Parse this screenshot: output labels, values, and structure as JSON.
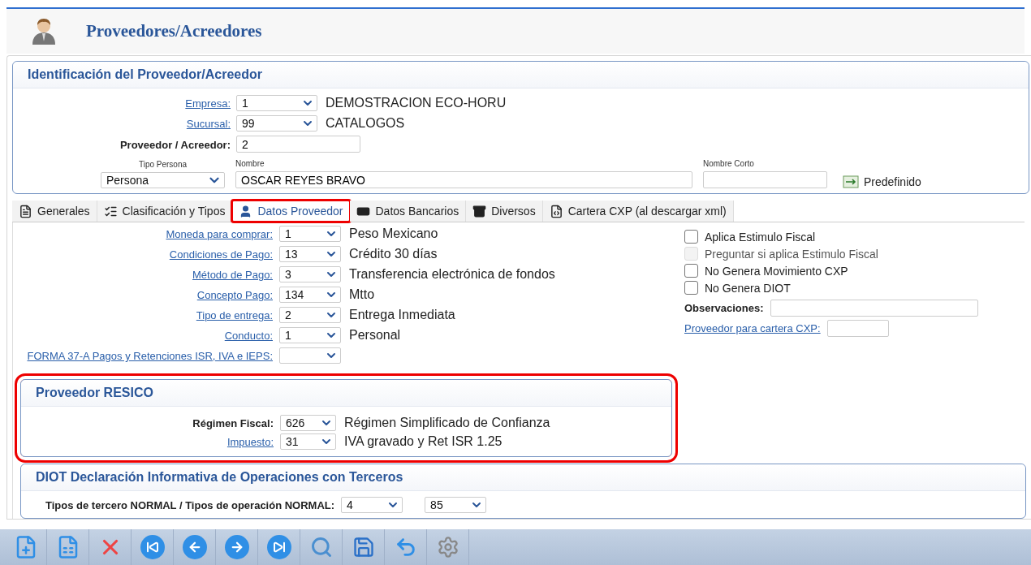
{
  "header": {
    "title": "Proveedores/Acreedores"
  },
  "identification": {
    "title": "Identificación del Proveedor/Acreedor",
    "fields": [
      {
        "kind": "select",
        "label": "Empresa:",
        "link": true,
        "value": "1",
        "description": "DEMOSTRACION ECO-HORU"
      },
      {
        "kind": "select",
        "label": "Sucursal:",
        "link": true,
        "value": "99",
        "description": "CATALOGOS"
      },
      {
        "kind": "input",
        "label": "Proveedor / Acreedor:",
        "link": false,
        "value": "2"
      }
    ],
    "tipo_persona": {
      "label": "Tipo Persona",
      "value": "Persona"
    },
    "nombre": {
      "label": "Nombre",
      "value": "OSCAR REYES BRAVO"
    },
    "nombre_corto": {
      "label": "Nombre Corto"
    },
    "predefinido_button": "Predefinido"
  },
  "tabs": [
    {
      "label": "Generales",
      "selected": false,
      "highlighted": false
    },
    {
      "label": "Clasificación y Tipos",
      "selected": false,
      "highlighted": false
    },
    {
      "label": "Datos Proveedor",
      "selected": true,
      "highlighted": true
    },
    {
      "label": "Datos Bancarios",
      "selected": false,
      "highlighted": false
    },
    {
      "label": "Diversos",
      "selected": false,
      "highlighted": false
    },
    {
      "label": "Cartera CXP (al descargar xml)",
      "selected": false,
      "highlighted": false
    }
  ],
  "datos_proveedor": {
    "fields": [
      {
        "label": "Moneda para comprar:",
        "value": "1",
        "description": "Peso Mexicano"
      },
      {
        "label": "Condiciones de Pago:",
        "value": "13",
        "description": "Crédito 30 días"
      },
      {
        "label": "Método de Pago:",
        "value": "3",
        "description": "Transferencia electrónica de fondos"
      },
      {
        "label": "Concepto Pago:",
        "value": "134",
        "description": "Mtto"
      },
      {
        "label": "Tipo de entrega:",
        "value": "2",
        "description": "Entrega Inmediata"
      },
      {
        "label": "Conducto:",
        "value": "1",
        "description": "Personal"
      },
      {
        "label": "FORMA 37-A Pagos y Retenciones ISR, IVA e IEPS:"
      }
    ],
    "checkboxes": [
      {
        "label": "Aplica Estimulo Fiscal",
        "checked": false,
        "disabled": false
      },
      {
        "label": "Preguntar si aplica Estimulo Fiscal",
        "checked": false,
        "disabled": true
      },
      {
        "label": "No Genera Movimiento CXP",
        "checked": false,
        "disabled": false
      },
      {
        "label": "No Genera DIOT",
        "checked": false,
        "disabled": false
      }
    ],
    "observaciones": {
      "label": "Observaciones:"
    },
    "cartera": {
      "label": "Proveedor para cartera CXP:"
    }
  },
  "resico": {
    "title": "Proveedor RESICO",
    "highlighted": true,
    "fields": [
      {
        "label": "Régimen Fiscal:",
        "link": false,
        "value": "626",
        "description": "Régimen Simplificado de Confianza"
      },
      {
        "label": "Impuesto:",
        "link": true,
        "value": "31",
        "description": "IVA gravado y Ret ISR 1.25"
      }
    ]
  },
  "diot": {
    "title": "DIOT Declaración Informativa de Operaciones con Terceros",
    "label": "Tipos de tercero NORMAL / Tipos de operación NORMAL:",
    "selects": [
      "4",
      "85"
    ]
  }
}
